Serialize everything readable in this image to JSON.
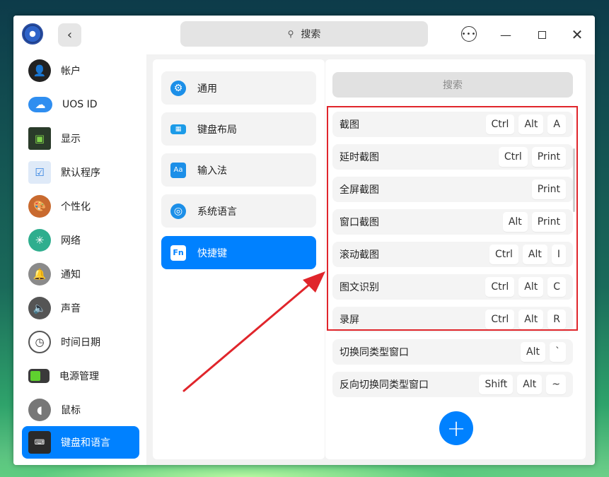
{
  "header": {
    "search_label": "搜索"
  },
  "sidebar": {
    "items": [
      {
        "label": "帐户",
        "icon": "user-icon"
      },
      {
        "label": "UOS ID",
        "icon": "cloud-icon"
      },
      {
        "label": "显示",
        "icon": "monitor-icon"
      },
      {
        "label": "默认程序",
        "icon": "default-apps-icon"
      },
      {
        "label": "个性化",
        "icon": "palette-icon"
      },
      {
        "label": "网络",
        "icon": "network-icon"
      },
      {
        "label": "通知",
        "icon": "bell-icon"
      },
      {
        "label": "声音",
        "icon": "speaker-icon"
      },
      {
        "label": "时间日期",
        "icon": "clock-icon"
      },
      {
        "label": "电源管理",
        "icon": "battery-icon"
      },
      {
        "label": "鼠标",
        "icon": "mouse-icon"
      },
      {
        "label": "键盘和语言",
        "icon": "keyboard-icon",
        "active": true
      }
    ]
  },
  "middle": {
    "items": [
      {
        "label": "通用",
        "icon": "gear-icon",
        "glyph": "⚙"
      },
      {
        "label": "键盘布局",
        "icon": "keyboard-layout-icon",
        "glyph": "▦"
      },
      {
        "label": "输入法",
        "icon": "input-method-icon",
        "glyph": "Aa"
      },
      {
        "label": "系统语言",
        "icon": "globe-icon",
        "glyph": "◎"
      },
      {
        "label": "快捷键",
        "icon": "fn-key-icon",
        "glyph": "Fn",
        "active": true
      }
    ]
  },
  "right": {
    "search_label": "搜索",
    "shortcuts": [
      {
        "name": "截图",
        "keys": [
          "Ctrl",
          "Alt",
          "A"
        ]
      },
      {
        "name": "延时截图",
        "keys": [
          "Ctrl",
          "Print"
        ]
      },
      {
        "name": "全屏截图",
        "keys": [
          "Print"
        ]
      },
      {
        "name": "窗口截图",
        "keys": [
          "Alt",
          "Print"
        ]
      },
      {
        "name": "滚动截图",
        "keys": [
          "Ctrl",
          "Alt",
          "I"
        ]
      },
      {
        "name": "图文识别",
        "keys": [
          "Ctrl",
          "Alt",
          "C"
        ]
      },
      {
        "name": "录屏",
        "keys": [
          "Ctrl",
          "Alt",
          "R"
        ]
      },
      {
        "name": "切换同类型窗口",
        "keys": [
          "Alt",
          "`"
        ]
      },
      {
        "name": "反向切换同类型窗口",
        "keys": [
          "Shift",
          "Alt",
          "~"
        ]
      }
    ],
    "add_label": "+"
  },
  "colors": {
    "accent": "#0081ff",
    "annotation": "#e0252b"
  }
}
